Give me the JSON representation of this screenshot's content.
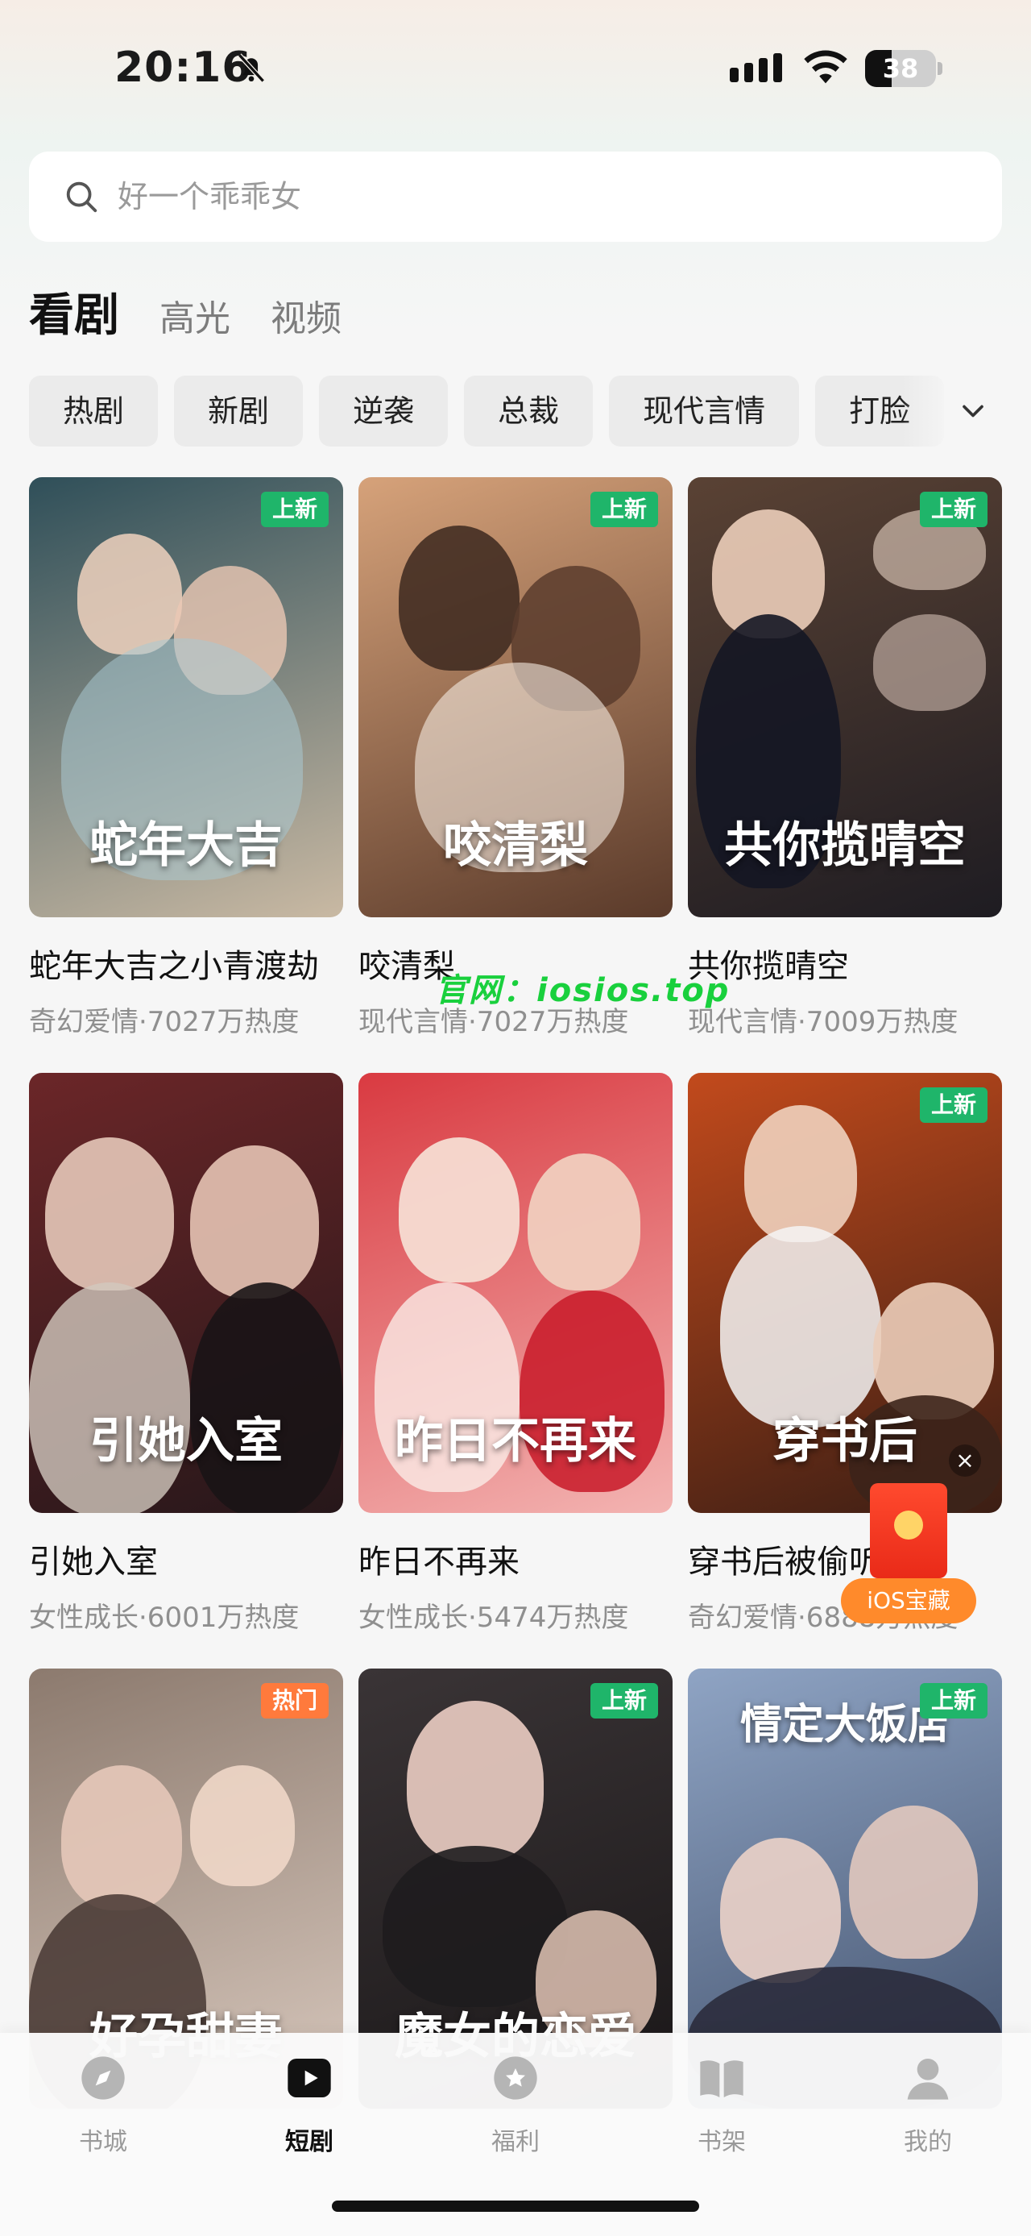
{
  "status_bar": {
    "time": "20:16",
    "battery": "38",
    "battery_level": 0.38
  },
  "search": {
    "placeholder": "好一个乖乖女"
  },
  "tabs": [
    {
      "label": "看剧",
      "active": true
    },
    {
      "label": "高光",
      "active": false
    },
    {
      "label": "视频",
      "active": false
    }
  ],
  "chips": [
    "热剧",
    "新剧",
    "逆袭",
    "总裁",
    "现代言情",
    "打脸"
  ],
  "dramas": [
    {
      "title": "蛇年大吉之小青渡劫",
      "poster_text": "蛇年大吉",
      "meta": "奇幻爱情·7027万热度",
      "badge": "上新",
      "badge_type": "new",
      "colors": [
        "#2f4f59",
        "#c9b9a3"
      ]
    },
    {
      "title": "咬清梨",
      "poster_text": "咬清梨",
      "meta": "现代言情·7027万热度",
      "badge": "上新",
      "badge_type": "new",
      "colors": [
        "#d6a27a",
        "#5a3a2a"
      ]
    },
    {
      "title": "共你揽晴空",
      "poster_text": "共你揽晴空",
      "meta": "现代言情·7009万热度",
      "badge": "上新",
      "badge_type": "new",
      "colors": [
        "#5a4234",
        "#1e1c22"
      ]
    },
    {
      "title": "引她入室",
      "poster_text": "引她入室",
      "meta": "女性成长·6001万热度",
      "badge": "",
      "badge_type": "",
      "colors": [
        "#6b2628",
        "#26171a"
      ]
    },
    {
      "title": "昨日不再来",
      "poster_text": "昨日不再来",
      "meta": "女性成长·5474万热度",
      "badge": "",
      "badge_type": "",
      "colors": [
        "#d93a41",
        "#f3b4b2"
      ]
    },
    {
      "title": "穿书后被偷听心声",
      "poster_text": "穿书后",
      "meta": "奇幻爱情·6888万热度",
      "badge": "上新",
      "badge_type": "new",
      "colors": [
        "#c24a1c",
        "#3b1e14"
      ]
    },
    {
      "title": "好孕甜妻",
      "poster_text": "好孕甜妻",
      "meta": "",
      "badge": "热门",
      "badge_type": "hot",
      "colors": [
        "#8c7a6e",
        "#d8c8bd"
      ]
    },
    {
      "title": "魔女的恋爱",
      "poster_text": "魔女的恋爱",
      "meta": "",
      "badge": "上新",
      "badge_type": "new",
      "colors": [
        "#3a3436",
        "#1a1718"
      ]
    },
    {
      "title": "情定大饭店",
      "poster_text": "情定大饭店",
      "meta": "",
      "badge": "上新",
      "badge_type": "new",
      "colors": [
        "#8fa4c4",
        "#41506b"
      ]
    }
  ],
  "watermark": "官网：iosios.top",
  "floating": {
    "label": "iOS宝藏",
    "close": "×"
  },
  "bottom_nav": [
    {
      "label": "书城",
      "icon": "compass-icon",
      "active": false
    },
    {
      "label": "短剧",
      "icon": "play-icon",
      "active": true
    },
    {
      "label": "福利",
      "icon": "gift-icon",
      "active": false
    },
    {
      "label": "书架",
      "icon": "book-icon",
      "active": false
    },
    {
      "label": "我的",
      "icon": "person-icon",
      "active": false
    }
  ]
}
